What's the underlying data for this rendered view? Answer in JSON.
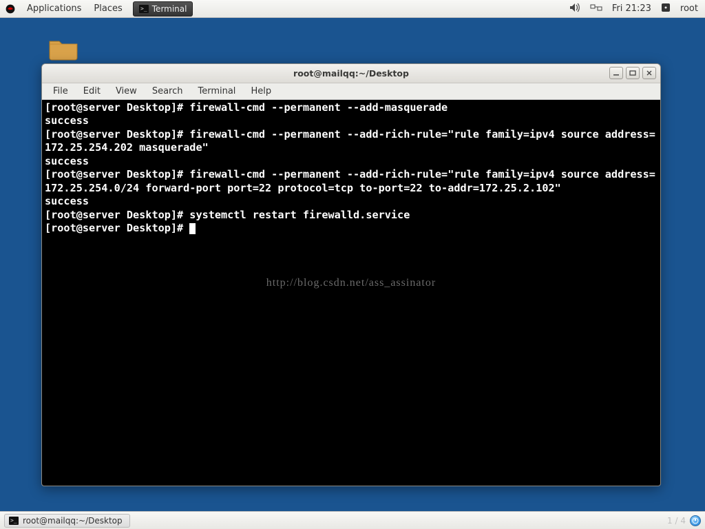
{
  "panel": {
    "applications": "Applications",
    "places": "Places",
    "task_terminal": "Terminal",
    "clock": "Fri 21:23",
    "user": "root"
  },
  "window": {
    "title": "root@mailqq:~/Desktop",
    "menu": {
      "file": "File",
      "edit": "Edit",
      "view": "View",
      "search": "Search",
      "terminal": "Terminal",
      "help": "Help"
    }
  },
  "terminal": {
    "lines": [
      "[root@server Desktop]# firewall-cmd --permanent --add-masquerade",
      "success",
      "[root@server Desktop]# firewall-cmd --permanent --add-rich-rule=\"rule family=ipv4 source address=172.25.254.202 masquerade\"",
      "success",
      "[root@server Desktop]# firewall-cmd --permanent --add-rich-rule=\"rule family=ipv4 source address=172.25.254.0/24 forward-port port=22 protocol=tcp to-port=22 to-addr=172.25.2.102\"",
      "success",
      "[root@server Desktop]# systemctl restart firewalld.service",
      "[root@server Desktop]# "
    ],
    "watermark": "http://blog.csdn.net/ass_assinator"
  },
  "bottom": {
    "task": "root@mailqq:~/Desktop",
    "pager": "1 / 4"
  }
}
